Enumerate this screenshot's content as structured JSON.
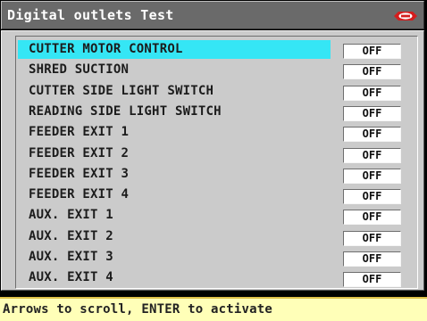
{
  "window": {
    "title": "Digital outlets Test",
    "logo_icon": "brand-logo-icon",
    "logo_color": "#d41d1d"
  },
  "outlets": [
    {
      "label": "CUTTER MOTOR CONTROL",
      "state": "OFF",
      "selected": true
    },
    {
      "label": "SHRED SUCTION",
      "state": "OFF",
      "selected": false
    },
    {
      "label": "CUTTER SIDE LIGHT SWITCH",
      "state": "OFF",
      "selected": false
    },
    {
      "label": "READING SIDE LIGHT SWITCH",
      "state": "OFF",
      "selected": false
    },
    {
      "label": "FEEDER EXIT 1",
      "state": "OFF",
      "selected": false
    },
    {
      "label": "FEEDER EXIT 2",
      "state": "OFF",
      "selected": false
    },
    {
      "label": "FEEDER EXIT 3",
      "state": "OFF",
      "selected": false
    },
    {
      "label": "FEEDER EXIT 4",
      "state": "OFF",
      "selected": false
    },
    {
      "label": "AUX. EXIT 1",
      "state": "OFF",
      "selected": false
    },
    {
      "label": "AUX. EXIT 2",
      "state": "OFF",
      "selected": false
    },
    {
      "label": "AUX. EXIT 3",
      "state": "OFF",
      "selected": false
    },
    {
      "label": "AUX. EXIT 4",
      "state": "OFF",
      "selected": false
    }
  ],
  "status": {
    "hint": "Arrows to scroll, ENTER to activate"
  },
  "colors": {
    "selection": "#35e6f5",
    "titlebar": "#6a6a6a",
    "panel": "#cbcbcb",
    "statusbar": "#ffffb8"
  }
}
